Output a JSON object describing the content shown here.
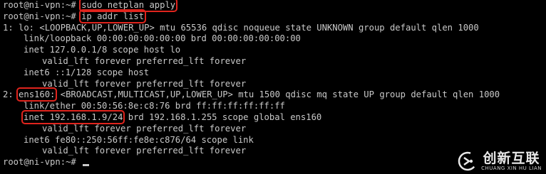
{
  "terminal": {
    "prompt": "root@ni-vpn:~# ",
    "commands": {
      "first": "sudo netplan apply",
      "second": "ip addr list"
    },
    "lo": {
      "header": "1: lo: <LOOPBACK,UP,LOWER_UP> mtu 65536 qdisc noqueue state UNKNOWN group default qlen 1000",
      "link": "link/loopback 00:00:00:00:00:00 brd 00:00:00:00:00:00",
      "inet": "inet 127.0.0.1/8 scope host lo",
      "inet_lft": "valid_lft forever preferred_lft forever",
      "inet6": "inet6 ::1/128 scope host",
      "inet6_lft": "valid_lft forever preferred_lft forever"
    },
    "ens160": {
      "index": "2: ",
      "name": "ens160:",
      "header_rest": " <BROADCAST,MULTICAST,UP,LOWER_UP> mtu 1500 qdisc mq state UP group default qlen 1000",
      "link": "link/ether 00:50:56:8e:c8:76 brd ff:ff:ff:ff:ff:ff",
      "inet_addr": "inet 192.168.1.9/24",
      "inet_rest": " brd 192.168.1.255 scope global ens160",
      "inet_lft": "valid_lft forever preferred_lft forever",
      "inet6": "inet6 fe80::250:56ff:fe8e:c876/64 scope link",
      "inet6_lft": "valid_lft forever preferred_lft forever"
    },
    "final_prompt": "root@ni-vpn:~# "
  },
  "watermark": {
    "cn": "创新互联",
    "en": "CHUANG XIN HU LIAN"
  },
  "colors": {
    "background": "#000000",
    "text": "#c9c9c9",
    "highlight": "#e0241d"
  }
}
